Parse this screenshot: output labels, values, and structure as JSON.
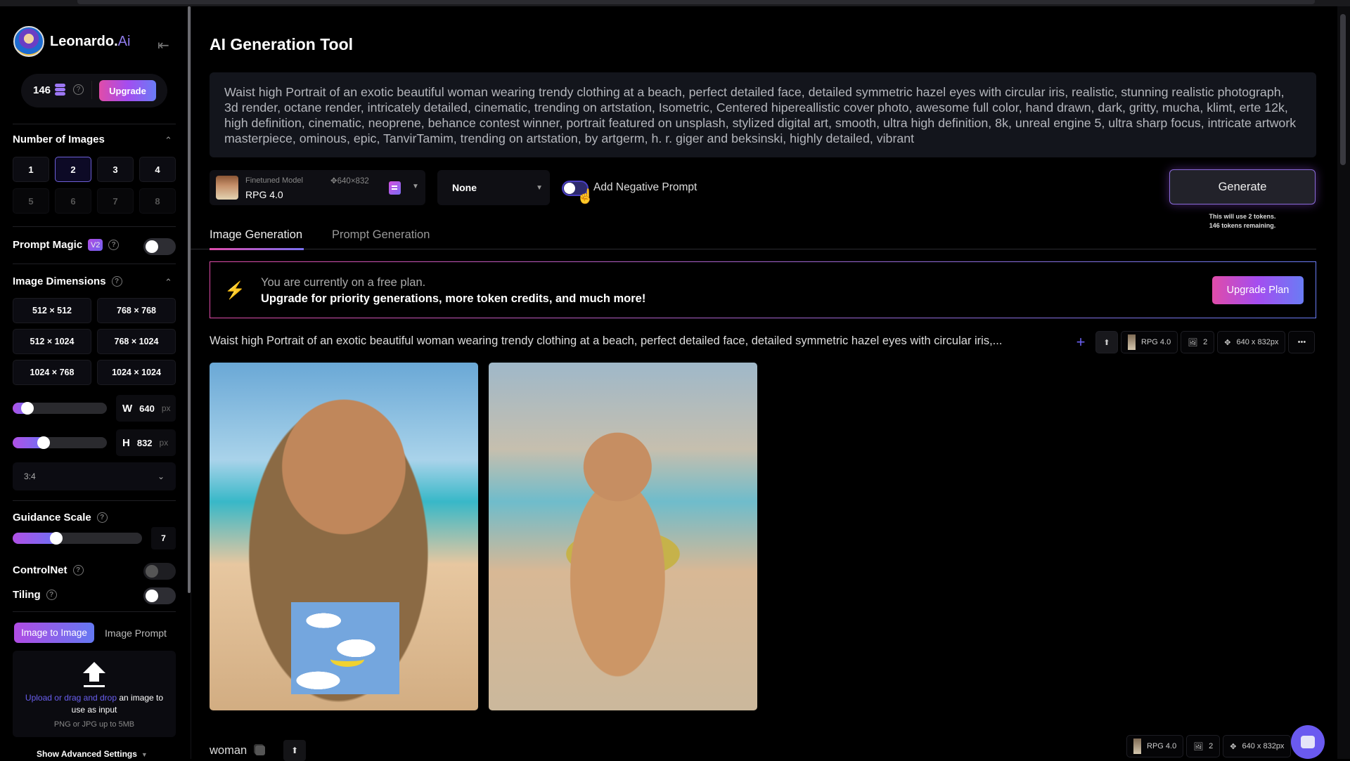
{
  "app": {
    "brand": "Leonardo.",
    "brand_suffix": "Ai",
    "tokens": "146",
    "upgrade_label": "Upgrade"
  },
  "sidebar": {
    "number_of_images": {
      "title": "Number of Images",
      "options": [
        "1",
        "2",
        "3",
        "4",
        "5",
        "6",
        "7",
        "8"
      ],
      "selected": "2",
      "disabled": [
        "5",
        "6",
        "7",
        "8"
      ]
    },
    "prompt_magic": {
      "title": "Prompt Magic",
      "badge": "V2",
      "enabled": false
    },
    "image_dimensions": {
      "title": "Image Dimensions",
      "presets": [
        "512 × 512",
        "768 × 768",
        "512 × 1024",
        "768 × 1024",
        "1024 × 768",
        "1024 × 1024"
      ],
      "width_label": "W",
      "width_value": "640",
      "height_label": "H",
      "height_value": "832",
      "unit": "px",
      "width_slider_fraction": 0.1,
      "height_slider_fraction": 0.3,
      "aspect_ratio": "3:4"
    },
    "guidance_scale": {
      "title": "Guidance Scale",
      "value": "7",
      "slider_fraction": 0.32
    },
    "controlnet": {
      "title": "ControlNet",
      "enabled": false
    },
    "tiling": {
      "title": "Tiling",
      "enabled": false
    },
    "mode_tabs": {
      "active": "Image to Image",
      "inactive": "Image Prompt"
    },
    "upload": {
      "link_text": "Upload or drag and drop",
      "text": " an image to use as input",
      "hint": "PNG or JPG up to 5MB"
    },
    "advanced_label": "Show Advanced Settings"
  },
  "main": {
    "title": "AI Generation Tool",
    "prompt": "Waist high Portrait of an exotic beautiful woman wearing trendy clothing at a beach,  perfect detailed face, detailed symmetric hazel eyes with circular iris, realistic, stunning realistic photograph, 3d render, octane render, intricately detailed, cinematic, trending on artstation, Isometric, Centered hipereallistic cover photo, awesome full color, hand drawn, dark, gritty, mucha, klimt, erte 12k, high definition, cinematic, neoprene, behance contest winner, portrait featured on unsplash, stylized digital art, smooth, ultra high definition, 8k, unreal engine 5, ultra sharp focus, intricate artwork masterpiece, ominous, epic, TanvirTamim, trending on artstation, by artgerm, h. r. giger and beksinski, highly detailed, vibrant",
    "model": {
      "kicker": "Finetuned Model",
      "dims": "640×832",
      "name": "RPG 4.0"
    },
    "style": "None",
    "negative_prompt": {
      "label": "Add Negative Prompt",
      "enabled": true
    },
    "generate": {
      "label": "Generate",
      "note_line1": "This will use 2 tokens.",
      "note_line2": "146 tokens remaining."
    },
    "tabs": [
      {
        "label": "Image Generation",
        "active": true
      },
      {
        "label": "Prompt Generation",
        "active": false
      }
    ],
    "banner": {
      "line1": "You are currently on a free plan.",
      "line2": "Upgrade for priority generations, more token credits, and much more!",
      "button": "Upgrade Plan"
    },
    "generations": [
      {
        "prompt": "Waist high Portrait of an exotic beautiful woman wearing trendy clothing at a beach, perfect detailed face, detailed symmetric hazel eyes with circular iris,...",
        "model": "RPG 4.0",
        "count": "2",
        "size": "640 x 832px",
        "images": [
          "generated-image-1",
          "generated-image-2"
        ]
      },
      {
        "prompt": "woman",
        "model": "RPG 4.0",
        "count": "2",
        "size": "640 x 832px"
      }
    ]
  },
  "colors": {
    "accent_purple": "#6a5ff0",
    "gradient_pink": "#e04ca9",
    "gradient_blue": "#6a7cf5",
    "bolt": "#f2c24a"
  }
}
